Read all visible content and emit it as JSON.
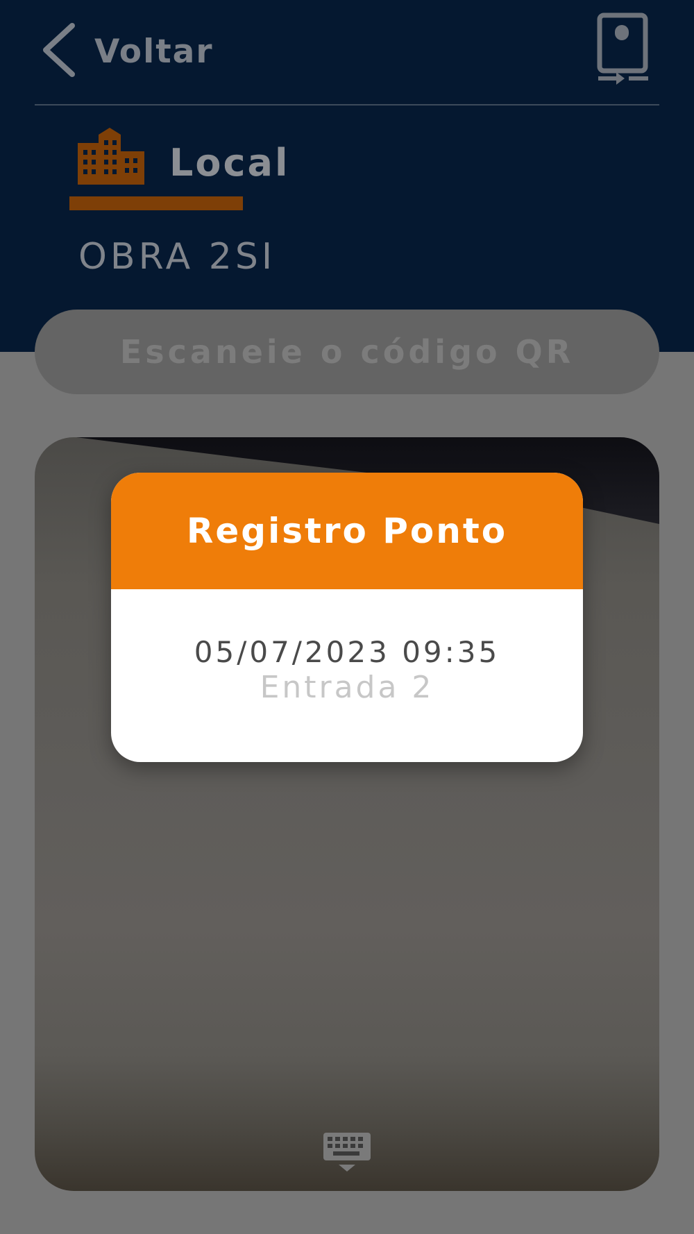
{
  "colors": {
    "header_bg": "#051830",
    "accent_orange": "#ef7d09",
    "muted_orange": "#7e3f07",
    "overlay_gray": "#767676"
  },
  "header": {
    "back_label": "Voltar",
    "back_icon": "chevron-left-icon",
    "device_icon": "device-switch-icon"
  },
  "location": {
    "icon": "building-icon",
    "title": "Local",
    "site_name": "OBRA 2SI"
  },
  "scan": {
    "label": "Escaneie o código QR"
  },
  "camera": {
    "keyboard_icon": "keyboard-icon"
  },
  "dialog": {
    "title": "Registro Ponto",
    "datetime": "05/07/2023 09:35",
    "entry_type": "Entrada 2"
  }
}
